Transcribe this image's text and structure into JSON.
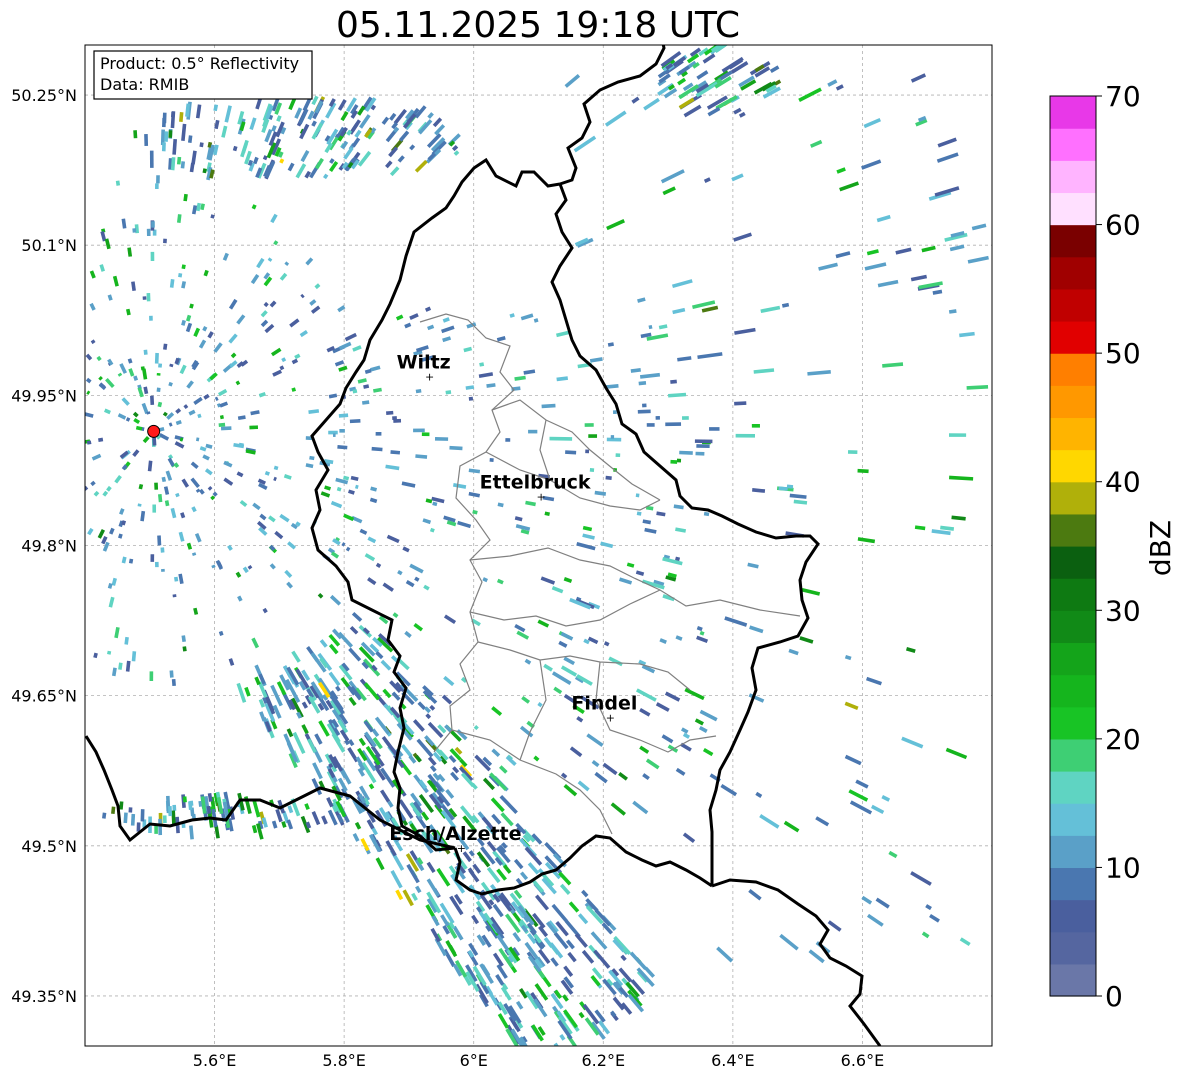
{
  "title": "05.11.2025 19:18 UTC",
  "info_box": {
    "product": "Product: 0.5° Reflectivity",
    "data": "Data: RMIB"
  },
  "map": {
    "lon_range": [
      5.4,
      6.8
    ],
    "lat_range": [
      49.3,
      50.3
    ],
    "x_ticks": [
      {
        "value": 5.6,
        "label": "5.6°E"
      },
      {
        "value": 5.8,
        "label": "5.8°E"
      },
      {
        "value": 6.0,
        "label": "6°E"
      },
      {
        "value": 6.2,
        "label": "6.2°E"
      },
      {
        "value": 6.4,
        "label": "6.4°E"
      },
      {
        "value": 6.6,
        "label": "6.6°E"
      }
    ],
    "y_ticks": [
      {
        "value": 50.25,
        "label": "50.25°N"
      },
      {
        "value": 50.1,
        "label": "50.1°N"
      },
      {
        "value": 49.95,
        "label": "49.95°N"
      },
      {
        "value": 49.8,
        "label": "49.8°N"
      },
      {
        "value": 49.65,
        "label": "49.65°N"
      },
      {
        "value": 49.5,
        "label": "49.5°N"
      },
      {
        "value": 49.35,
        "label": "49.35°N"
      }
    ],
    "gridlines": true,
    "radar_site": {
      "lon": 5.506,
      "lat": 49.914
    },
    "cities": [
      {
        "name": "Wiltz",
        "lon": 5.932,
        "lat": 49.967
      },
      {
        "name": "Ettelbruck",
        "lon": 6.104,
        "lat": 49.847
      },
      {
        "name": "Findel",
        "lon": 6.211,
        "lat": 49.626
      },
      {
        "name": "Esch/Alzette",
        "lon": 5.981,
        "lat": 49.496
      }
    ],
    "border_color": "#000000",
    "canton_color": "#808080"
  },
  "colorbar": {
    "label": "dBZ",
    "ticks": [
      "0",
      "10",
      "20",
      "30",
      "40",
      "50",
      "60",
      "70"
    ],
    "min": 0,
    "max": 70,
    "step": 2.5,
    "colors": [
      "#6a77a8",
      "#5566a0",
      "#4a5f9e",
      "#4a77b0",
      "#5aa0c8",
      "#64c0d8",
      "#5fd4c2",
      "#3ecf74",
      "#18c425",
      "#15b51d",
      "#14a41a",
      "#118a17",
      "#0e7a12",
      "#0b6010",
      "#4c7a10",
      "#b0b00a",
      "#ffd700",
      "#ffb400",
      "#ff9800",
      "#ff7f00",
      "#e10000",
      "#c00000",
      "#a00000",
      "#7a0000",
      "#ffe0ff",
      "#ffb4ff",
      "#ff70ff",
      "#e838e8"
    ]
  }
}
